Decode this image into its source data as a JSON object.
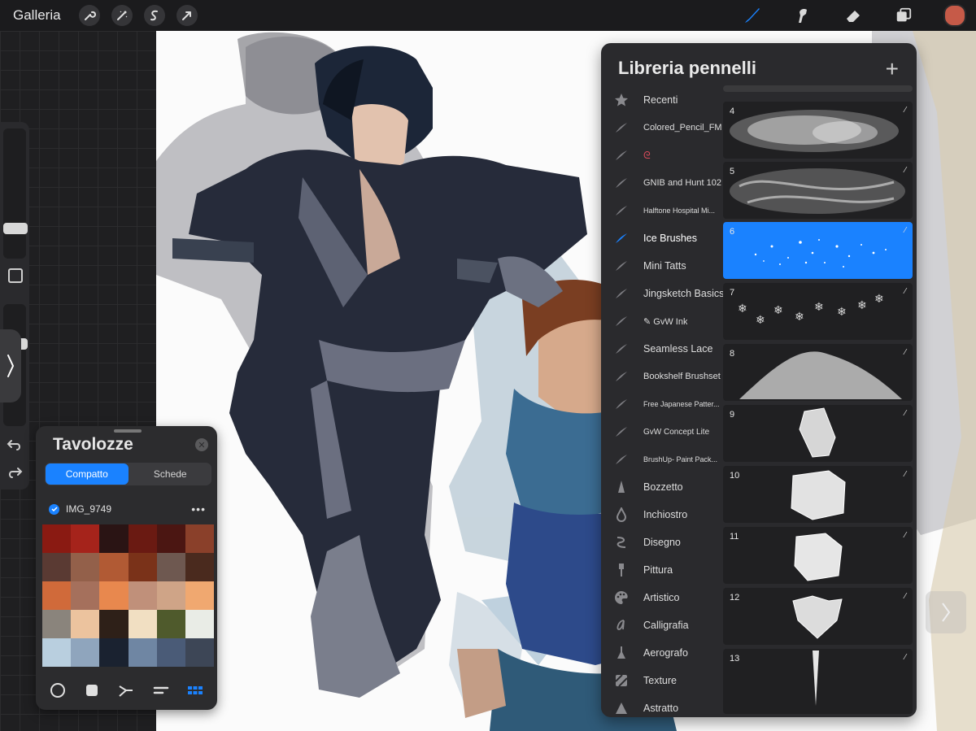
{
  "topbar": {
    "gallery_label": "Galleria",
    "tools": [
      "wrench-icon",
      "magic-wand-icon",
      "selection-icon",
      "transform-icon"
    ],
    "right_tools": [
      "brush-icon",
      "smudge-icon",
      "eraser-icon",
      "layers-icon"
    ],
    "current_color": "#c65a48"
  },
  "palettes": {
    "title": "Tavolozze",
    "tab_compact": "Compatto",
    "tab_cards": "Schede",
    "palette_name": "IMG_9749",
    "more_label": "•••",
    "swatches": [
      "#8a1a12",
      "#a5231b",
      "#2a1414",
      "#6a1a12",
      "#4b1612",
      "#8a402a",
      "#5a3a33",
      "#93604a",
      "#b15a34",
      "#7a3219",
      "#6e5850",
      "#4a2a1e",
      "#d06a3a",
      "#a5705c",
      "#e8884e",
      "#c0907a",
      "#cfa487",
      "#f0a870",
      "#8a847c",
      "#ecc39e",
      "#2e2018",
      "#f1dfc2",
      "#4f5a2c",
      "#e9ece6",
      "#b9cfdf",
      "#8fa5bd",
      "#1a2230",
      "#6f86a3",
      "#4a5b77",
      "#3d4656"
    ]
  },
  "brush_library": {
    "title": "Libreria pennelli",
    "add_label": "+",
    "sets": [
      {
        "label": "Recenti",
        "icon": "star-icon"
      },
      {
        "label": "Colored_Pencil_FM",
        "icon": "brush-stroke-icon"
      },
      {
        "label": "ᘓ",
        "icon": "brush-stroke-icon"
      },
      {
        "label": "GNIB and Hunt 102",
        "icon": "brush-stroke-icon"
      },
      {
        "label": "Halftone Hospital Mi...",
        "icon": "brush-stroke-icon"
      },
      {
        "label": "Ice Brushes",
        "icon": "brush-stroke-icon"
      },
      {
        "label": "Mini Tatts",
        "icon": "brush-stroke-icon"
      },
      {
        "label": "Jingsketch Basics",
        "icon": "brush-stroke-icon"
      },
      {
        "label": "✎ GvW Ink",
        "icon": "brush-stroke-icon"
      },
      {
        "label": "Seamless Lace",
        "icon": "brush-stroke-icon"
      },
      {
        "label": "Bookshelf Brushset",
        "icon": "brush-stroke-icon"
      },
      {
        "label": "Free Japanese Patter...",
        "icon": "brush-stroke-icon"
      },
      {
        "label": "GvW Concept Lite",
        "icon": "brush-stroke-icon"
      },
      {
        "label": "BrushUp- Paint Pack...",
        "icon": "brush-stroke-icon"
      },
      {
        "label": "Bozzetto",
        "icon": "pencil-tip-icon"
      },
      {
        "label": "Inchiostro",
        "icon": "ink-drop-icon"
      },
      {
        "label": "Disegno",
        "icon": "squiggle-icon"
      },
      {
        "label": "Pittura",
        "icon": "paint-brush-icon"
      },
      {
        "label": "Artistico",
        "icon": "palette-icon"
      },
      {
        "label": "Calligrafia",
        "icon": "calligraphy-icon"
      },
      {
        "label": "Aerografo",
        "icon": "airbrush-icon"
      },
      {
        "label": "Texture",
        "icon": "texture-icon"
      },
      {
        "label": "Astratto",
        "icon": "triangle-icon"
      }
    ],
    "brushes": [
      {
        "num": "4"
      },
      {
        "num": "5"
      },
      {
        "num": "6"
      },
      {
        "num": "7"
      },
      {
        "num": "8"
      },
      {
        "num": "9"
      },
      {
        "num": "10"
      },
      {
        "num": "11"
      },
      {
        "num": "12"
      },
      {
        "num": "13"
      }
    ]
  }
}
